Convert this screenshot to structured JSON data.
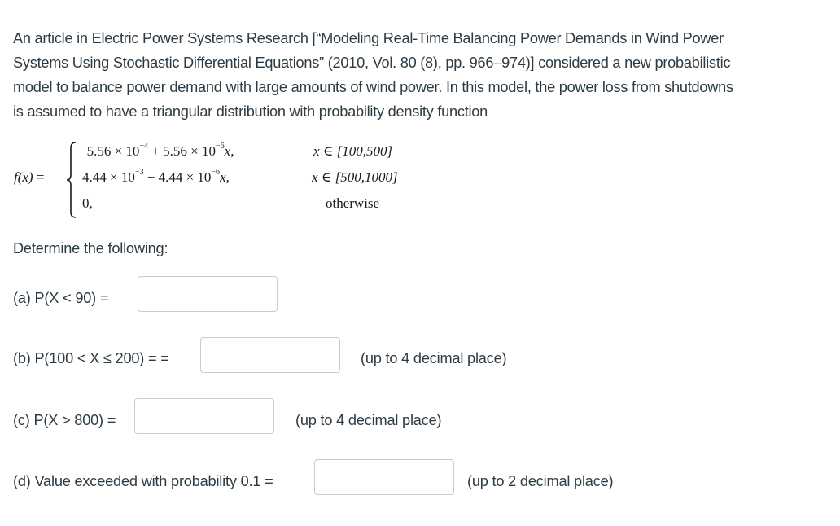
{
  "intro": {
    "lines": [
      "An article in Electric Power Systems Research [“Modeling Real-Time Balancing Power Demands in Wind Power",
      "Systems Using Stochastic Differential Equations” (2010, Vol. 80 (8), pp. 966–974)] considered a new probabilistic",
      "model to balance power demand with large amounts of wind power. In this model, the power loss from shutdowns",
      "is assumed to have a triangular distribution with probability density function"
    ]
  },
  "formula": {
    "lhs": "f(x)",
    "eq": " =",
    "cases": [
      {
        "expr_a": "−5.56 × 10",
        "exp_a": "−4",
        "expr_b": " + 5.56 × 10",
        "exp_b": "−6",
        "var": "x,",
        "cond": "x ∈ [100,500]"
      },
      {
        "expr_a": "4.44 × 10",
        "exp_a": "−3",
        "expr_b": " − 4.44 × 10",
        "exp_b": "−6",
        "var": "x,",
        "cond": "x ∈ [500,1000]"
      },
      {
        "expr_a": "0,",
        "exp_a": "",
        "expr_b": "",
        "exp_b": "",
        "var": "",
        "cond": "otherwise"
      }
    ]
  },
  "prompt": "Determine the following:",
  "questions": [
    {
      "label": "(a) P(X < 90)   =",
      "value": "",
      "hint": ""
    },
    {
      "label": "(b) P(100 < X ≤ 200) = =",
      "value": "",
      "hint": "(up to 4 decimal place)"
    },
    {
      "label": "(c) P(X > 800) =",
      "value": "",
      "hint": "(up to 4 decimal place)"
    },
    {
      "label": "(d) Value exceeded with probability 0.1 =",
      "value": "",
      "hint": "(up to 2 decimal place)"
    }
  ]
}
